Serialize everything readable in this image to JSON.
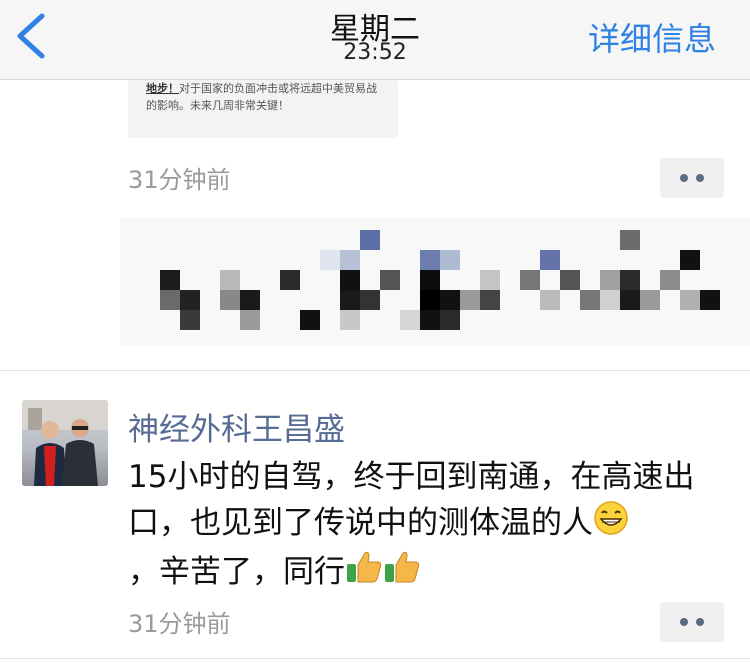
{
  "navbar": {
    "day": "星期二",
    "time": "23:52",
    "detail_label": "详细信息"
  },
  "shared_card": {
    "bold_text": "地步！",
    "text": "对于国家的负面冲击或将远超中美贸易战的影响。未来几周非常关键！"
  },
  "post1": {
    "timestamp": "31分钟前"
  },
  "post2": {
    "username": "神经外科王昌盛",
    "text_part1": "15小时的自驾，终于回到南通，在高速出口，也见到了传说中的测体温的人",
    "text_part2": "，辛苦了，同行",
    "emojis": [
      "grinning-face-icon",
      "thumbs-up-icon",
      "thumbs-up-icon"
    ],
    "timestamp": "31分钟前"
  },
  "colors": {
    "accent": "#2f82e4",
    "username": "#576b95",
    "timestamp": "#9a9a9a"
  }
}
